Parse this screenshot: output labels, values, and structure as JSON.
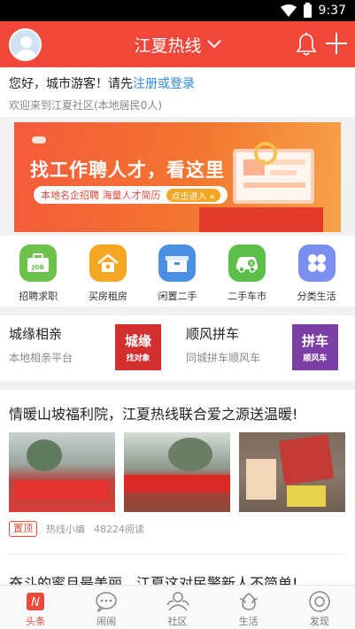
{
  "status_bar": {
    "time": "9:37"
  },
  "header": {
    "title": "江夏热线"
  },
  "welcome": {
    "greeting": "您好，城市游客！请先",
    "login_link": "注册或登录",
    "subtitle": "欢迎来到江夏社区(本地居民0人)"
  },
  "banner": {
    "headline": "找工作聘人才，看这里",
    "sub": "本地名企招聘 海量人才简历",
    "enter": "点击进入 »"
  },
  "categories": [
    {
      "label": "招聘求职",
      "icon": "job-icon",
      "color": "#6cc24a"
    },
    {
      "label": "买房租房",
      "icon": "house-icon",
      "color": "#f5a623"
    },
    {
      "label": "闲置二手",
      "icon": "box-icon",
      "color": "#4a90e2"
    },
    {
      "label": "二手车市",
      "icon": "car-icon",
      "color": "#5cbf4a"
    },
    {
      "label": "分类生活",
      "icon": "grid-icon",
      "color": "#7b8ff0"
    }
  ],
  "promos": [
    {
      "title": "城缘相亲",
      "desc": "本地相亲平台",
      "img_big": "城缘",
      "img_small": "找对象",
      "color": "#d42f2f"
    },
    {
      "title": "顺风拼车",
      "desc": "同城拼车顺风车",
      "img_big": "拼车",
      "img_small": "顺风车",
      "color": "#7b3fa6"
    }
  ],
  "news": [
    {
      "title": "情暖山坡福利院，江夏热线联合爱之源送温暖!",
      "pin": "置顶",
      "author": "热线小编",
      "reads": "48224阅读"
    },
    {
      "title": "奋斗的蜜月最美丽，江夏这对民警新人不简单!"
    }
  ],
  "tabs": [
    {
      "label": "头条",
      "icon": "headline-icon",
      "active": true
    },
    {
      "label": "闹闹",
      "icon": "chat-icon",
      "active": false
    },
    {
      "label": "社区",
      "icon": "community-icon",
      "active": false
    },
    {
      "label": "生活",
      "icon": "life-icon",
      "active": false
    },
    {
      "label": "发现",
      "icon": "discover-icon",
      "active": false
    }
  ],
  "colors": {
    "brand": "#f0473a",
    "link": "#2e8be6"
  }
}
